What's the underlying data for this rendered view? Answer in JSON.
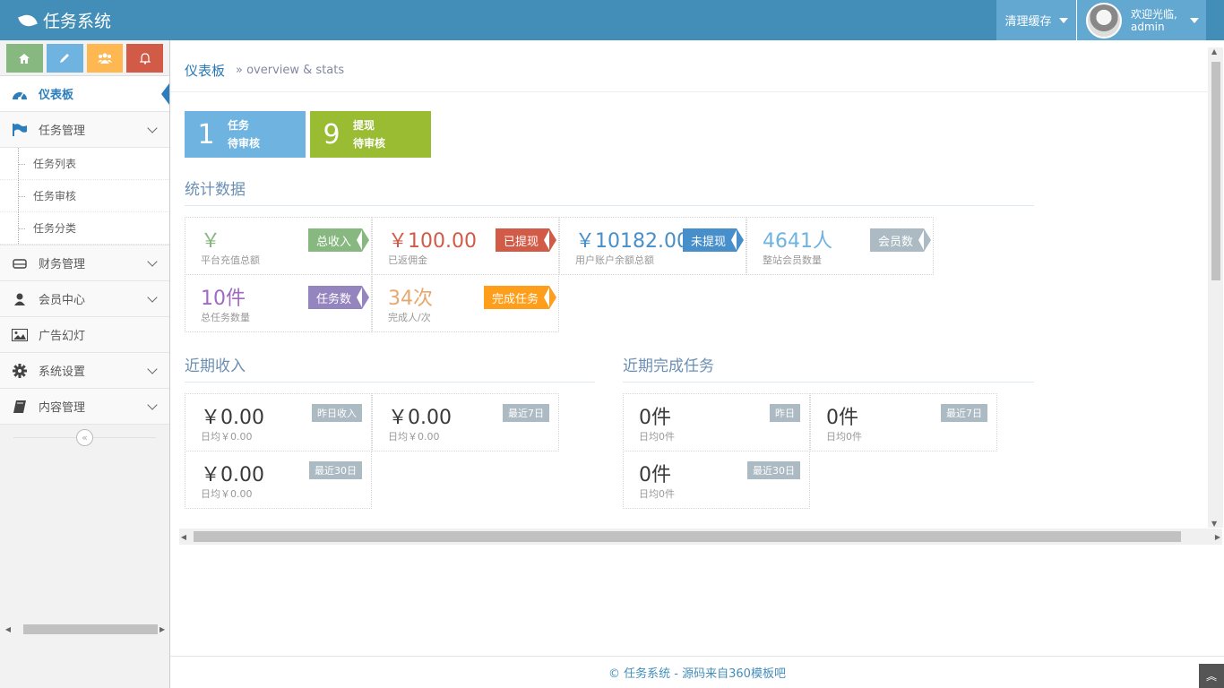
{
  "navbar": {
    "brand": "任务系统",
    "clear_cache": "清理缓存",
    "welcome": "欢迎光临,",
    "username": "admin"
  },
  "sidebar": {
    "shortcuts": [
      "home-icon",
      "pencil-icon",
      "users-icon",
      "bell-icon"
    ],
    "items": [
      {
        "label": "仪表板",
        "icon": "dashboard-icon",
        "active": true
      },
      {
        "label": "任务管理",
        "icon": "flag-icon",
        "expanded": true,
        "children": [
          "任务列表",
          "任务审核",
          "任务分类"
        ]
      },
      {
        "label": "财务管理",
        "icon": "hdd-icon"
      },
      {
        "label": "会员中心",
        "icon": "user-icon"
      },
      {
        "label": "广告幻灯",
        "icon": "picture-icon"
      },
      {
        "label": "系统设置",
        "icon": "cog-icon"
      },
      {
        "label": "内容管理",
        "icon": "book-icon"
      }
    ]
  },
  "breadcrumb": {
    "title": "仪表板",
    "subtitle": "» overview & stats"
  },
  "pending": [
    {
      "num": "1",
      "line1": "任务",
      "line2": "待审核",
      "color": "#6fb3e0"
    },
    {
      "num": "9",
      "line1": "提现",
      "line2": "待审核",
      "color": "#9abc32"
    }
  ],
  "stats": {
    "title": "统计数据",
    "boxes": [
      {
        "value": "￥",
        "label": "平台充值总额",
        "badge": "总收入",
        "value_color": "#87b87f",
        "badge_color": "#87b87f"
      },
      {
        "value": "￥100.00",
        "label": "已返佣金",
        "badge": "已提现",
        "value_color": "#d15b47",
        "badge_color": "#d15b47"
      },
      {
        "value": "￥10182.00",
        "label": "用户账户余额总额",
        "badge": "未提现",
        "value_color": "#478fca",
        "badge_color": "#478fca"
      },
      {
        "value": "4641人",
        "label": "整站会员数量",
        "badge": "会员数",
        "value_color": "#6fb3e0",
        "badge_color": "#abbac3"
      },
      {
        "value": "10件",
        "label": "总任务数量",
        "badge": "任务数",
        "value_color": "#a069c3",
        "badge_color": "#9585bf"
      },
      {
        "value": "34次",
        "label": "完成人/次",
        "badge": "完成任务",
        "value_color": "#e7a86f",
        "badge_color": "#ff9e1a"
      }
    ]
  },
  "income": {
    "title": "近期收入",
    "boxes": [
      {
        "value": "￥0.00",
        "label": "日均￥0.00",
        "badge": "昨日收入"
      },
      {
        "value": "￥0.00",
        "label": "日均￥0.00",
        "badge": "最近7日"
      },
      {
        "value": "￥0.00",
        "label": "日均￥0.00",
        "badge": "最近30日"
      }
    ]
  },
  "tasks": {
    "title": "近期完成任务",
    "boxes": [
      {
        "value": "0件",
        "label": "日均0件",
        "badge": "昨日"
      },
      {
        "value": "0件",
        "label": "日均0件",
        "badge": "最近7日"
      },
      {
        "value": "0件",
        "label": "日均0件",
        "badge": "最近30日"
      }
    ]
  },
  "footer": {
    "text": "© 任务系统 - 源码来自360模板吧"
  }
}
